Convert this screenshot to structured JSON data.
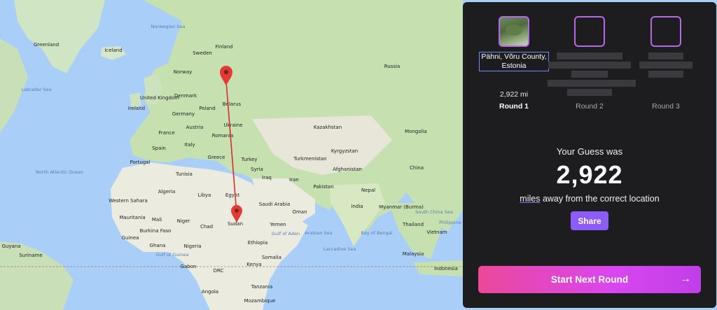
{
  "map": {
    "country_labels": [
      "Greenland",
      "Iceland",
      "Finland",
      "Sweden",
      "Norway",
      "Russia",
      "Denmark",
      "United Kingdom",
      "Ireland",
      "Belarus",
      "Poland",
      "Germany",
      "Ukraine",
      "France",
      "Austria",
      "Romania",
      "Italy",
      "Spain",
      "Portugal",
      "Greece",
      "Turkey",
      "Kazakhstan",
      "Mongolia",
      "Kyrgyzstan",
      "Turkmenistan",
      "Afghanistan",
      "Pakistan",
      "Iran",
      "Iraq",
      "Syria",
      "China",
      "Nepal",
      "India",
      "Myanmar (Burma)",
      "Thailand",
      "Vietnam",
      "Malaysia",
      "Indonesia",
      "Tunisia",
      "Algeria",
      "Libya",
      "Egypt",
      "Saudi Arabia",
      "Oman",
      "Yemen",
      "Western Sahara",
      "Mauritania",
      "Mali",
      "Niger",
      "Chad",
      "Sudan",
      "Ethiopia",
      "Burkina Faso",
      "Guinea",
      "Ghana",
      "Nigeria",
      "Somalia",
      "Kenya",
      "Gabon",
      "DRC",
      "Tanzania",
      "Angola",
      "Mozambique",
      "Guyana",
      "Suriname"
    ],
    "ocean_labels": [
      "Norwegian Sea",
      "Labrador Sea",
      "North Atlantic Ocean",
      "Arabian Sea",
      "Gulf of Aden",
      "Bay of Bengal",
      "Laccadive Sea",
      "Gulf of Guinea",
      "South China Sea",
      "Philippine Sea"
    ],
    "marker_colors": {
      "pin": "#e53935",
      "line": "#d32f2f"
    }
  },
  "panel": {
    "rounds": [
      {
        "location": [
          "Pähni, Võru County,",
          "Estonia"
        ],
        "distance": "2,922 mi",
        "label": "Round 1"
      },
      {
        "label": "Round 2"
      },
      {
        "label": "Round 3"
      }
    ],
    "result_title": "Your Guess was",
    "result_value": "2,922",
    "result_unit": "miles",
    "result_suffix": " away from the correct location",
    "share_label": "Share",
    "next_round_label": "Start Next Round",
    "next_round_icon": "arrow-right-icon"
  }
}
